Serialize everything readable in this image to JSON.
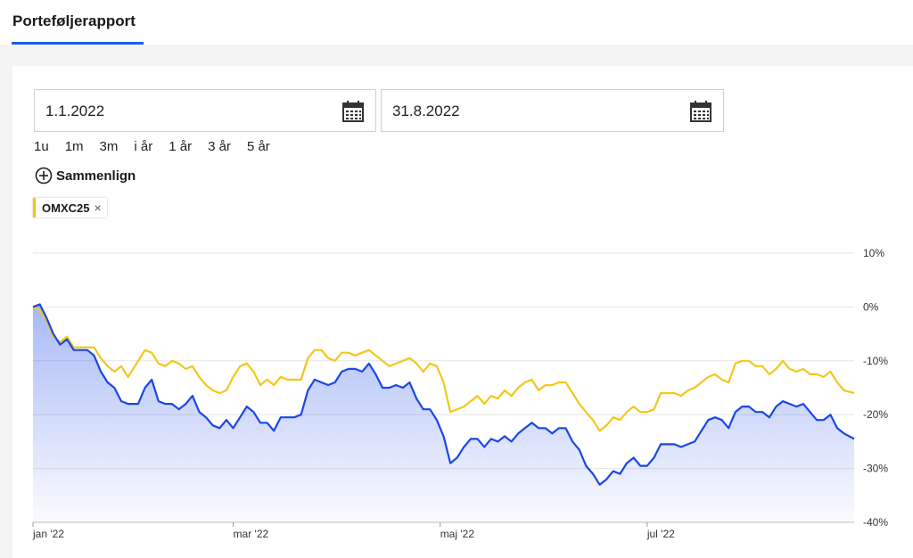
{
  "header": {
    "title": "Porteføljerapport"
  },
  "date_range": {
    "from": "1.1.2022",
    "to": "31.8.2022",
    "calendar_icon": "calendar-icon"
  },
  "ranges": [
    "1u",
    "1m",
    "3m",
    "i år",
    "1 år",
    "3 år",
    "5 år"
  ],
  "compare": {
    "label": "Sammenlign",
    "icon": "plus-circle-icon"
  },
  "chip": {
    "label": "OMXC25",
    "close": "×",
    "color": "#f0c419"
  },
  "colors": {
    "accent": "#1f5be8",
    "portfolio": "#1946e8",
    "benchmark": "#f3c71b"
  },
  "chart_data": {
    "type": "line",
    "title": "",
    "xlabel": "",
    "ylabel": "",
    "ylim": [
      -40,
      10
    ],
    "y_ticks": [
      "10%",
      "0%",
      "-10%",
      "-20%",
      "-30%",
      "-40%"
    ],
    "y_tick_values": [
      10,
      0,
      -10,
      -20,
      -30,
      -40
    ],
    "x_ticks": [
      "jan '22",
      "mar '22",
      "maj '22",
      "jul '22"
    ],
    "x_tick_values": [
      "2022-01-01",
      "2022-03-01",
      "2022-05-01",
      "2022-07-01"
    ],
    "grid": true,
    "series": [
      {
        "color": "#1946e8",
        "fill": true,
        "points": [
          [
            "2022-01-01",
            0
          ],
          [
            "2022-01-03",
            0.5
          ],
          [
            "2022-01-05",
            -2
          ],
          [
            "2022-01-07",
            -5
          ],
          [
            "2022-01-09",
            -7
          ],
          [
            "2022-01-11",
            -6
          ],
          [
            "2022-01-13",
            -8
          ],
          [
            "2022-01-17",
            -8
          ],
          [
            "2022-01-19",
            -9
          ],
          [
            "2022-01-21",
            -12
          ],
          [
            "2022-01-23",
            -14
          ],
          [
            "2022-01-25",
            -15
          ],
          [
            "2022-01-27",
            -17.5
          ],
          [
            "2022-01-29",
            -18
          ],
          [
            "2022-02-01",
            -18
          ],
          [
            "2022-02-03",
            -15
          ],
          [
            "2022-02-05",
            -13.5
          ],
          [
            "2022-02-07",
            -17.5
          ],
          [
            "2022-02-09",
            -18
          ],
          [
            "2022-02-11",
            -18
          ],
          [
            "2022-02-13",
            -19
          ],
          [
            "2022-02-15",
            -18
          ],
          [
            "2022-02-17",
            -16.5
          ],
          [
            "2022-02-19",
            -19.5
          ],
          [
            "2022-02-21",
            -20.5
          ],
          [
            "2022-02-23",
            -22
          ],
          [
            "2022-02-25",
            -22.5
          ],
          [
            "2022-02-27",
            -21
          ],
          [
            "2022-03-01",
            -22.5
          ],
          [
            "2022-03-03",
            -20.5
          ],
          [
            "2022-03-05",
            -18.5
          ],
          [
            "2022-03-07",
            -19.5
          ],
          [
            "2022-03-09",
            -21.5
          ],
          [
            "2022-03-11",
            -21.5
          ],
          [
            "2022-03-13",
            -23
          ],
          [
            "2022-03-15",
            -20.5
          ],
          [
            "2022-03-17",
            -20.5
          ],
          [
            "2022-03-19",
            -20.5
          ],
          [
            "2022-03-21",
            -20
          ],
          [
            "2022-03-23",
            -15.5
          ],
          [
            "2022-03-25",
            -13.5
          ],
          [
            "2022-03-27",
            -14
          ],
          [
            "2022-03-29",
            -14.5
          ],
          [
            "2022-03-31",
            -14
          ],
          [
            "2022-04-02",
            -12
          ],
          [
            "2022-04-04",
            -11.5
          ],
          [
            "2022-04-06",
            -11.5
          ],
          [
            "2022-04-08",
            -12
          ],
          [
            "2022-04-10",
            -10.5
          ],
          [
            "2022-04-12",
            -12.5
          ],
          [
            "2022-04-14",
            -15
          ],
          [
            "2022-04-16",
            -15
          ],
          [
            "2022-04-18",
            -14.5
          ],
          [
            "2022-04-20",
            -15
          ],
          [
            "2022-04-22",
            -14
          ],
          [
            "2022-04-24",
            -17
          ],
          [
            "2022-04-26",
            -19
          ],
          [
            "2022-04-28",
            -19
          ],
          [
            "2022-04-30",
            -21
          ],
          [
            "2022-05-02",
            -24
          ],
          [
            "2022-05-04",
            -29
          ],
          [
            "2022-05-06",
            -28
          ],
          [
            "2022-05-08",
            -26
          ],
          [
            "2022-05-10",
            -24.5
          ],
          [
            "2022-05-12",
            -24.5
          ],
          [
            "2022-05-14",
            -26
          ],
          [
            "2022-05-16",
            -24.5
          ],
          [
            "2022-05-18",
            -25
          ],
          [
            "2022-05-20",
            -24
          ],
          [
            "2022-05-22",
            -25
          ],
          [
            "2022-05-24",
            -23.5
          ],
          [
            "2022-05-26",
            -22.5
          ],
          [
            "2022-05-28",
            -21.5
          ],
          [
            "2022-05-30",
            -22.5
          ],
          [
            "2022-06-01",
            -22.5
          ],
          [
            "2022-06-03",
            -23.5
          ],
          [
            "2022-06-05",
            -22.5
          ],
          [
            "2022-06-07",
            -22.5
          ],
          [
            "2022-06-09",
            -25
          ],
          [
            "2022-06-11",
            -26.5
          ],
          [
            "2022-06-13",
            -29.5
          ],
          [
            "2022-06-15",
            -31
          ],
          [
            "2022-06-17",
            -33
          ],
          [
            "2022-06-19",
            -32
          ],
          [
            "2022-06-21",
            -30.5
          ],
          [
            "2022-06-23",
            -31
          ],
          [
            "2022-06-25",
            -29
          ],
          [
            "2022-06-27",
            -28
          ],
          [
            "2022-06-29",
            -29.5
          ],
          [
            "2022-07-01",
            -29.5
          ],
          [
            "2022-07-03",
            -28
          ],
          [
            "2022-07-05",
            -25.5
          ],
          [
            "2022-07-07",
            -25.5
          ],
          [
            "2022-07-09",
            -25.5
          ],
          [
            "2022-07-11",
            -26
          ],
          [
            "2022-07-13",
            -25.5
          ],
          [
            "2022-07-15",
            -25
          ],
          [
            "2022-07-17",
            -23
          ],
          [
            "2022-07-19",
            -21
          ],
          [
            "2022-07-21",
            -20.5
          ],
          [
            "2022-07-23",
            -21
          ],
          [
            "2022-07-25",
            -22.5
          ],
          [
            "2022-07-27",
            -19.5
          ],
          [
            "2022-07-29",
            -18.5
          ],
          [
            "2022-07-31",
            -18.5
          ],
          [
            "2022-08-02",
            -19.5
          ],
          [
            "2022-08-04",
            -19.5
          ],
          [
            "2022-08-06",
            -20.5
          ],
          [
            "2022-08-08",
            -18.5
          ],
          [
            "2022-08-10",
            -17.5
          ],
          [
            "2022-08-12",
            -18
          ],
          [
            "2022-08-14",
            -18.5
          ],
          [
            "2022-08-16",
            -18
          ],
          [
            "2022-08-18",
            -19.5
          ],
          [
            "2022-08-20",
            -21
          ],
          [
            "2022-08-22",
            -21
          ],
          [
            "2022-08-24",
            -20
          ],
          [
            "2022-08-26",
            -22.5
          ],
          [
            "2022-08-28",
            -23.5
          ],
          [
            "2022-08-31",
            -24.5
          ]
        ]
      },
      {
        "name": "OMXC25",
        "color": "#f3c71b",
        "fill": false,
        "points": [
          [
            "2022-01-01",
            0
          ],
          [
            "2022-01-03",
            -0.5
          ],
          [
            "2022-01-05",
            -2.5
          ],
          [
            "2022-01-07",
            -5.5
          ],
          [
            "2022-01-09",
            -6.5
          ],
          [
            "2022-01-11",
            -5.5
          ],
          [
            "2022-01-13",
            -7.5
          ],
          [
            "2022-01-17",
            -7.5
          ],
          [
            "2022-01-19",
            -7.5
          ],
          [
            "2022-01-21",
            -9.5
          ],
          [
            "2022-01-23",
            -11
          ],
          [
            "2022-01-25",
            -12
          ],
          [
            "2022-01-27",
            -11
          ],
          [
            "2022-01-29",
            -13
          ],
          [
            "2022-02-01",
            -10
          ],
          [
            "2022-02-03",
            -8
          ],
          [
            "2022-02-05",
            -8.5
          ],
          [
            "2022-02-07",
            -10.5
          ],
          [
            "2022-02-09",
            -11
          ],
          [
            "2022-02-11",
            -10
          ],
          [
            "2022-02-13",
            -10.5
          ],
          [
            "2022-02-15",
            -11.5
          ],
          [
            "2022-02-17",
            -11
          ],
          [
            "2022-02-19",
            -13
          ],
          [
            "2022-02-21",
            -14.5
          ],
          [
            "2022-02-23",
            -15.5
          ],
          [
            "2022-02-25",
            -16
          ],
          [
            "2022-02-27",
            -15.5
          ],
          [
            "2022-03-01",
            -13
          ],
          [
            "2022-03-03",
            -11
          ],
          [
            "2022-03-05",
            -10.5
          ],
          [
            "2022-03-07",
            -12
          ],
          [
            "2022-03-09",
            -14.5
          ],
          [
            "2022-03-11",
            -13.5
          ],
          [
            "2022-03-13",
            -14.5
          ],
          [
            "2022-03-15",
            -13
          ],
          [
            "2022-03-17",
            -13.5
          ],
          [
            "2022-03-19",
            -13.5
          ],
          [
            "2022-03-21",
            -13.5
          ],
          [
            "2022-03-23",
            -9.5
          ],
          [
            "2022-03-25",
            -8
          ],
          [
            "2022-03-27",
            -8
          ],
          [
            "2022-03-29",
            -9.5
          ],
          [
            "2022-03-31",
            -10
          ],
          [
            "2022-04-02",
            -8.5
          ],
          [
            "2022-04-04",
            -8.5
          ],
          [
            "2022-04-06",
            -9
          ],
          [
            "2022-04-08",
            -8.5
          ],
          [
            "2022-04-10",
            -8
          ],
          [
            "2022-04-12",
            -9
          ],
          [
            "2022-04-14",
            -10
          ],
          [
            "2022-04-16",
            -11
          ],
          [
            "2022-04-18",
            -10.5
          ],
          [
            "2022-04-20",
            -10
          ],
          [
            "2022-04-22",
            -9.5
          ],
          [
            "2022-04-24",
            -10.5
          ],
          [
            "2022-04-26",
            -12
          ],
          [
            "2022-04-28",
            -10.5
          ],
          [
            "2022-04-30",
            -11
          ],
          [
            "2022-05-02",
            -14
          ],
          [
            "2022-05-04",
            -19.5
          ],
          [
            "2022-05-06",
            -19
          ],
          [
            "2022-05-08",
            -18.5
          ],
          [
            "2022-05-10",
            -17.5
          ],
          [
            "2022-05-12",
            -16.5
          ],
          [
            "2022-05-14",
            -18
          ],
          [
            "2022-05-16",
            -16.5
          ],
          [
            "2022-05-18",
            -17
          ],
          [
            "2022-05-20",
            -15.5
          ],
          [
            "2022-05-22",
            -16.5
          ],
          [
            "2022-05-24",
            -15
          ],
          [
            "2022-05-26",
            -14
          ],
          [
            "2022-05-28",
            -13.5
          ],
          [
            "2022-05-30",
            -15.5
          ],
          [
            "2022-06-01",
            -14.5
          ],
          [
            "2022-06-03",
            -14.5
          ],
          [
            "2022-06-05",
            -14
          ],
          [
            "2022-06-07",
            -14
          ],
          [
            "2022-06-09",
            -16
          ],
          [
            "2022-06-11",
            -18
          ],
          [
            "2022-06-13",
            -19.5
          ],
          [
            "2022-06-15",
            -21
          ],
          [
            "2022-06-17",
            -23
          ],
          [
            "2022-06-19",
            -22
          ],
          [
            "2022-06-21",
            -20.5
          ],
          [
            "2022-06-23",
            -21
          ],
          [
            "2022-06-25",
            -19.5
          ],
          [
            "2022-06-27",
            -18.5
          ],
          [
            "2022-06-29",
            -19.5
          ],
          [
            "2022-07-01",
            -19.5
          ],
          [
            "2022-07-03",
            -19
          ],
          [
            "2022-07-05",
            -16
          ],
          [
            "2022-07-07",
            -16
          ],
          [
            "2022-07-09",
            -16
          ],
          [
            "2022-07-11",
            -16.5
          ],
          [
            "2022-07-13",
            -15.5
          ],
          [
            "2022-07-15",
            -15
          ],
          [
            "2022-07-17",
            -14
          ],
          [
            "2022-07-19",
            -13
          ],
          [
            "2022-07-21",
            -12.5
          ],
          [
            "2022-07-23",
            -13.5
          ],
          [
            "2022-07-25",
            -14
          ],
          [
            "2022-07-27",
            -10.5
          ],
          [
            "2022-07-29",
            -10
          ],
          [
            "2022-07-31",
            -10
          ],
          [
            "2022-08-02",
            -11
          ],
          [
            "2022-08-04",
            -11
          ],
          [
            "2022-08-06",
            -12.5
          ],
          [
            "2022-08-08",
            -11.5
          ],
          [
            "2022-08-10",
            -10
          ],
          [
            "2022-08-12",
            -11.5
          ],
          [
            "2022-08-14",
            -12
          ],
          [
            "2022-08-16",
            -11.5
          ],
          [
            "2022-08-18",
            -12.5
          ],
          [
            "2022-08-20",
            -12.5
          ],
          [
            "2022-08-22",
            -13
          ],
          [
            "2022-08-24",
            -12
          ],
          [
            "2022-08-26",
            -14
          ],
          [
            "2022-08-28",
            -15.5
          ],
          [
            "2022-08-31",
            -16
          ]
        ]
      }
    ]
  }
}
